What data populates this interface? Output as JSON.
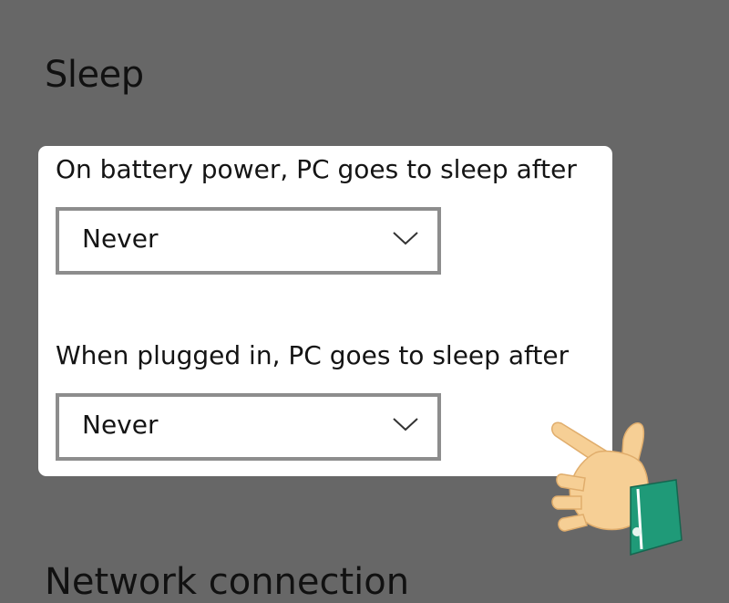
{
  "section_title": "Sleep",
  "battery": {
    "label": "On battery power, PC goes to sleep after",
    "value": "Never"
  },
  "plugged": {
    "label": "When plugged in, PC goes to sleep after",
    "value": "Never"
  },
  "next_section_title": "Network connection",
  "icons": {
    "dropdown": "chevron-down-icon",
    "pointer": "pointing-hand-icon"
  },
  "colors": {
    "background": "#676767",
    "panel": "#ffffff",
    "text": "#141414",
    "select_border": "#8d8d8d",
    "hand_skin": "#f6cf95",
    "cuff": "#1f9a78"
  }
}
